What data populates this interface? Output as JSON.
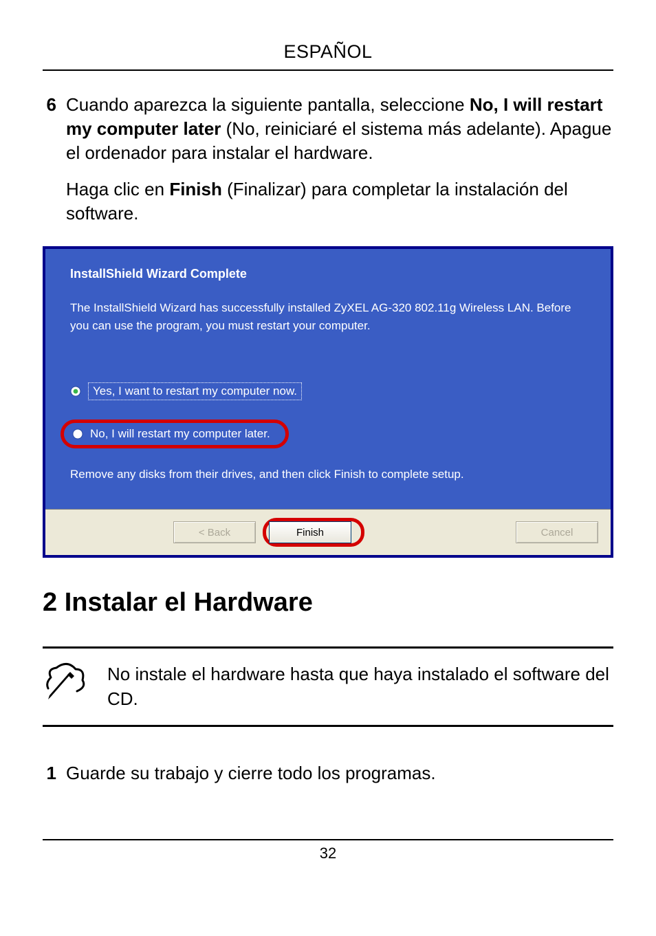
{
  "header": {
    "title": "ESPAÑOL"
  },
  "step6": {
    "number": "6",
    "para1_prefix": "Cuando aparezca la siguiente pantalla, seleccione ",
    "para1_bold": "No, I will restart my computer later",
    "para1_suffix": " (No, reiniciaré el sistema más adelante). Apague el ordenador para instalar el hardware.",
    "para2_prefix": "Haga clic en ",
    "para2_bold": "Finish",
    "para2_suffix": " (Finalizar) para completar la instalación del software."
  },
  "wizard": {
    "title": "InstallShield Wizard Complete",
    "desc": "The InstallShield Wizard has successfully installed ZyXEL AG-320 802.11g Wireless LAN.  Before you can use the program, you must restart your computer.",
    "radio_yes": "Yes, I want to restart my computer now.",
    "radio_no": "No, I will restart my computer later.",
    "remove": "Remove any disks from their drives, and then click Finish to complete setup.",
    "buttons": {
      "back": "< Back",
      "finish": "Finish",
      "cancel": "Cancel"
    }
  },
  "section2": {
    "heading": "2 Instalar el Hardware"
  },
  "note": {
    "text": "No instale el hardware hasta que haya instalado el software del CD."
  },
  "step1": {
    "number": "1",
    "text": "Guarde su trabajo y cierre todo los programas."
  },
  "footer": {
    "page": "32"
  }
}
